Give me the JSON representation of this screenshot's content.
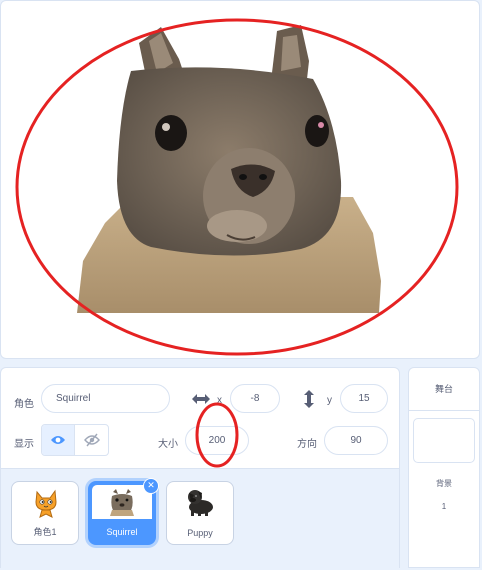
{
  "stage": {
    "sprite_image": "squirrel-photo",
    "annotation_color": "#e52222"
  },
  "sprite_info": {
    "sprite_label": "角色",
    "sprite_name": "Squirrel",
    "x_label": "x",
    "x_value": "-8",
    "y_label": "y",
    "y_value": "15",
    "show_label": "显示",
    "size_label": "大小",
    "size_value": "200",
    "direction_label": "方向",
    "direction_value": "90",
    "x_icon": "horizontal-arrows-icon",
    "y_icon": "vertical-arrows-icon",
    "show_icon": "eye-icon",
    "hide_icon": "eye-slash-icon"
  },
  "sprites": [
    {
      "name": "角色1",
      "icon": "scratch-cat-icon",
      "selected": false
    },
    {
      "name": "Squirrel",
      "icon": "squirrel-thumbnail",
      "selected": true
    },
    {
      "name": "Puppy",
      "icon": "puppy-thumbnail",
      "selected": false
    }
  ],
  "backdrop_panel": {
    "title": "舞台",
    "backdrops_label": "背景",
    "backdrops_count": "1"
  },
  "colors": {
    "accent": "#4c97ff",
    "annotation": "#e52222"
  }
}
